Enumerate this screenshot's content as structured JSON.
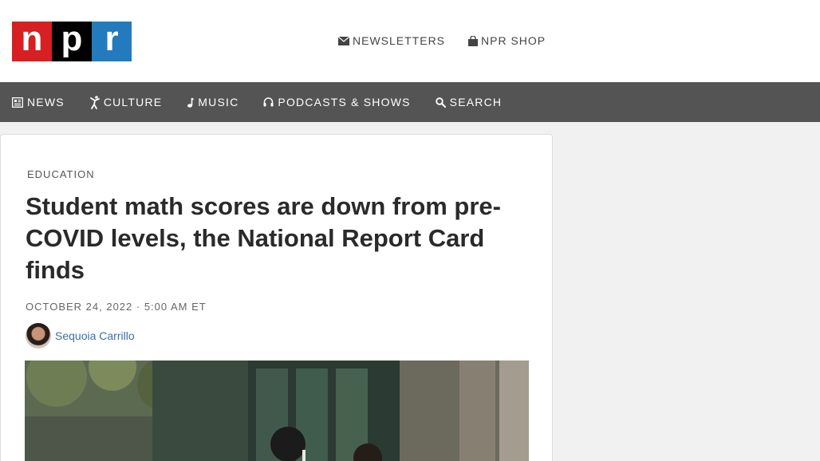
{
  "logo": {
    "letters": [
      "n",
      "p",
      "r"
    ]
  },
  "header": {
    "links": [
      {
        "label": "NEWSLETTERS",
        "icon": "envelope-icon"
      },
      {
        "label": "NPR SHOP",
        "icon": "shopping-bag-icon"
      }
    ]
  },
  "nav": {
    "items": [
      {
        "label": "NEWS",
        "icon": "news-icon"
      },
      {
        "label": "CULTURE",
        "icon": "culture-icon"
      },
      {
        "label": "MUSIC",
        "icon": "music-note-icon"
      },
      {
        "label": "PODCASTS & SHOWS",
        "icon": "headphones-icon"
      },
      {
        "label": "SEARCH",
        "icon": "search-icon"
      }
    ]
  },
  "article": {
    "slug": "EDUCATION",
    "headline": "Student math scores are down from pre-COVID levels, the National Report Card finds",
    "dateline": "OCTOBER 24, 2022 · 5:00 AM ET",
    "author": "Sequoia Carrillo"
  },
  "colors": {
    "npr_red": "#d62021",
    "npr_black": "#000000",
    "npr_blue": "#237bbd",
    "navbar": "#545454",
    "author_link": "#3d6ea5"
  }
}
